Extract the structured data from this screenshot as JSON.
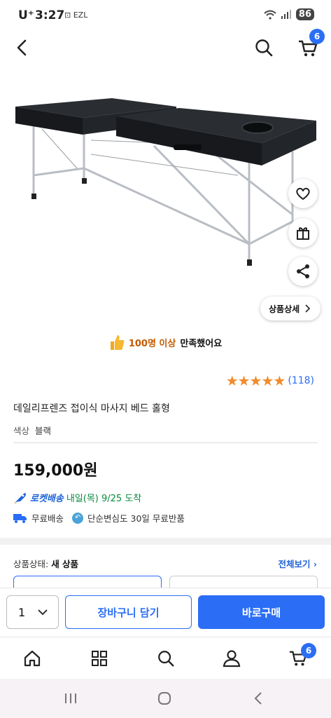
{
  "status_bar": {
    "carrier": "U⁺",
    "time": "3:27",
    "extra": "EZL",
    "battery": "86"
  },
  "top_nav": {
    "cart_badge": "6"
  },
  "image_overlay": {
    "detail_button": "상품상세"
  },
  "satisfaction": {
    "count": "100명 이상",
    "text": "만족했어요"
  },
  "rating": {
    "stars": "★★★★★",
    "count": "(118)"
  },
  "product": {
    "title": "데일리프렌즈 접이식 마사지 베드 홀형",
    "option_label": "색상",
    "option_value": "블랙",
    "price": "159,000원"
  },
  "delivery": {
    "rocket_label": "로켓배송",
    "arrival": "내일(목) 9/25 도착",
    "free_shipping": "무료배송",
    "free_return": "단순변심도 30일 무료반품"
  },
  "condition": {
    "label": "상품상태:",
    "value": "새 상품",
    "view_all": "전체보기"
  },
  "buy_bar": {
    "quantity": "1",
    "add_to_cart": "장바구니 담기",
    "buy_now": "바로구매"
  },
  "bottom_nav": {
    "cart_badge": "6"
  },
  "colors": {
    "primary": "#2b6ef5",
    "rocket": "#1f63d9",
    "arrival": "#0a8a3d",
    "star": "#f38a2b"
  }
}
